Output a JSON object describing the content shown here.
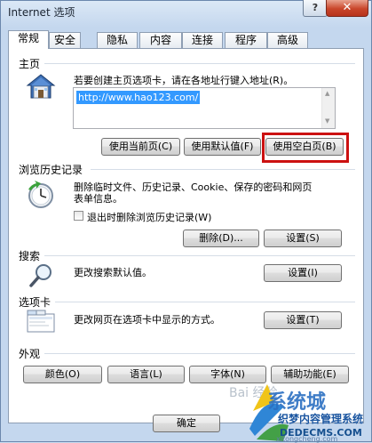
{
  "window": {
    "title": "Internet 选项",
    "help_label": "?",
    "close_label": "✕"
  },
  "tabs": [
    {
      "label": "常规"
    },
    {
      "label": "安全"
    },
    {
      "label": "隐私"
    },
    {
      "label": "内容"
    },
    {
      "label": "连接"
    },
    {
      "label": "程序"
    },
    {
      "label": "高级"
    }
  ],
  "home": {
    "heading": "主页",
    "instruction": "若要创建主页选项卡，请在各地址行键入地址(R)。",
    "url_value": "http://www.hao123.com/",
    "btn_current": "使用当前页(C)",
    "btn_default": "使用默认值(F)",
    "btn_blank": "使用空白页(B)"
  },
  "history": {
    "heading": "浏览历史记录",
    "description_line1": "删除临时文件、历史记录、Cookie、保存的密码和网页",
    "description_line2": "表单信息。",
    "checkbox_label": "退出时删除浏览历史记录(W)",
    "btn_delete": "删除(D)...",
    "btn_settings": "设置(S)"
  },
  "search": {
    "heading": "搜索",
    "description": "更改搜索默认值。",
    "btn_settings": "设置(I)"
  },
  "tabs_section": {
    "heading": "选项卡",
    "description": "更改网页在选项卡中显示的方式。",
    "btn_settings": "设置(T)"
  },
  "appearance": {
    "heading": "外观",
    "btn_colors": "颜色(O)",
    "btn_languages": "语言(L)",
    "btn_fonts": "字体(N)",
    "btn_accessibility": "辅助功能(E)"
  },
  "footer": {
    "btn_ok": "确定"
  },
  "watermark": {
    "baidu": "Bai 经验",
    "brand": "系统城",
    "site_cn": "织梦内容管理系统",
    "site_en": "DEDECMS.COM",
    "site_url": "xitongcheng.com"
  },
  "colors": {
    "highlight_border": "#cc1111",
    "selection": "#3399ff",
    "close_button": "#c9452a"
  }
}
